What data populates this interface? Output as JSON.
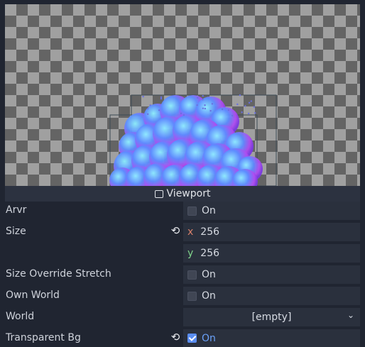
{
  "viewport": {
    "label": "Viewport",
    "icon": "viewport-icon"
  },
  "properties": {
    "arvr": {
      "label": "Arvr",
      "value": "On",
      "checked": false
    },
    "size": {
      "label": "Size",
      "x_axis": "x",
      "x": "256",
      "y_axis": "y",
      "y": "256",
      "revert_icon": "revert-icon"
    },
    "size_override_stretch": {
      "label": "Size Override Stretch",
      "value": "On",
      "checked": false
    },
    "own_world": {
      "label": "Own World",
      "value": "On",
      "checked": false
    },
    "world": {
      "label": "World",
      "value": "[empty]",
      "icon": "chevron-down-icon"
    },
    "transparent_bg": {
      "label": "Transparent Bg",
      "value": "On",
      "checked": true,
      "revert_icon": "revert-icon"
    }
  },
  "colors": {
    "panel_bg": "#202531",
    "field_bg": "#2a303d",
    "accent": "#5a8df0"
  }
}
